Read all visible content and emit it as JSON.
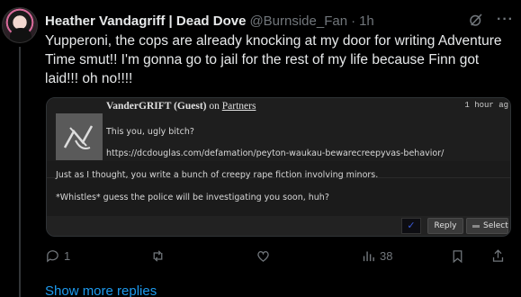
{
  "tweet": {
    "author_name": "Heather Vandagriff | Dead Dove",
    "handle": "@Burnside_Fan",
    "separator": "·",
    "time": "1h",
    "text": "Yupperoni, the cops are already knocking at my door for writing Adventure Time smut!! I'm gonna go to jail for the rest of my life because Finn got laid!!! oh no!!!!"
  },
  "card": {
    "author": "VanderGRIFT (Guest)",
    "on_text": "on",
    "board": "Partners",
    "time": "1 hour ag",
    "line1": "This you, ugly bitch?",
    "line2": "https://dcdouglas.com/defamation/peyton-waukau-bewarecreepyvas-behavior/",
    "line3": "Just as I thought, you write a bunch of creepy rape fiction involving minors.",
    "line4": "*Whistles* guess the police will be investigating you soon, huh?",
    "check_symbol": "✓",
    "reply_label": "Reply",
    "select_label": "Select"
  },
  "actions": {
    "replies": "1",
    "retweets": "",
    "likes": "",
    "views": "38"
  },
  "show_more": "Show more replies",
  "colors": {
    "background": "#000000",
    "text": "#e7e9ea",
    "muted": "#71767b",
    "link": "#1d9bf0"
  }
}
